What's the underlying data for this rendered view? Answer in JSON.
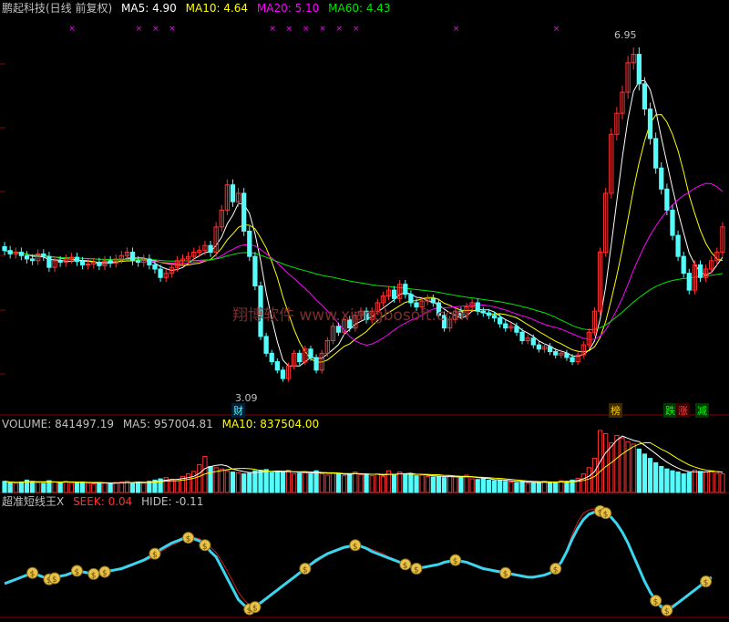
{
  "header": {
    "title": "鹏起科技(日线 前复权)",
    "ma5": "MA5: 4.90",
    "ma10": "MA10: 4.64",
    "ma20": "MA20: 5.10",
    "ma60": "MA60: 4.43"
  },
  "volume_header": {
    "label": "VOLUME: 841497.19",
    "ma5": "MA5: 957004.81",
    "ma10": "MA10: 837504.00"
  },
  "indicator_header": {
    "name": "超准短线王X",
    "seek": "SEEK: 0.04",
    "hide": "HIDE: -0.11"
  },
  "annotations": {
    "high_label": "6.95",
    "low_label": "3.09",
    "cai": "财",
    "bang": "榜",
    "die": "跌",
    "zhang": "涨",
    "jian": "减",
    "watermark": "翔博软件 www.xiangbosoft.com"
  },
  "colors": {
    "up": "#ff3232",
    "down": "#54fcfc",
    "ma5": "#ffffff",
    "ma10": "#ffff00",
    "ma20": "#ff00ff",
    "ma60": "#00e600",
    "seek": "#3ad6f0",
    "hide": "#cc1a1a",
    "marker": "#ff00ff"
  },
  "chart_data": {
    "type": "candlestick",
    "price_range": [
      2.7,
      7.4
    ],
    "closes": [
      4.62,
      4.58,
      4.6,
      4.56,
      4.52,
      4.5,
      4.58,
      4.55,
      4.42,
      4.5,
      4.48,
      4.52,
      4.54,
      4.49,
      4.45,
      4.46,
      4.48,
      4.44,
      4.5,
      4.47,
      4.52,
      4.56,
      4.6,
      4.5,
      4.48,
      4.52,
      4.45,
      4.4,
      4.3,
      4.35,
      4.42,
      4.5,
      4.52,
      4.55,
      4.6,
      4.62,
      4.68,
      4.6,
      4.9,
      5.1,
      5.4,
      5.2,
      5.3,
      4.85,
      4.55,
      4.2,
      3.6,
      3.4,
      3.3,
      3.2,
      3.1,
      3.25,
      3.4,
      3.3,
      3.45,
      3.35,
      3.2,
      3.4,
      3.55,
      3.72,
      3.65,
      3.8,
      3.7,
      3.85,
      3.9,
      3.8,
      3.9,
      4.0,
      4.08,
      4.15,
      4.05,
      4.22,
      4.1,
      4.0,
      3.95,
      4.02,
      4.05,
      4.0,
      3.85,
      3.7,
      3.8,
      3.9,
      3.85,
      3.95,
      4.0,
      3.9,
      3.88,
      3.85,
      3.82,
      3.75,
      3.7,
      3.72,
      3.65,
      3.55,
      3.58,
      3.5,
      3.45,
      3.48,
      3.42,
      3.38,
      3.4,
      3.35,
      3.3,
      3.38,
      3.5,
      3.65,
      3.9,
      4.6,
      5.3,
      6.0,
      6.25,
      6.5,
      6.85,
      6.95,
      6.6,
      6.3,
      5.95,
      5.6,
      5.35,
      5.1,
      4.8,
      4.55,
      4.35,
      4.15,
      4.45,
      4.3,
      4.4,
      4.5,
      4.6,
      4.9
    ],
    "volumes": [
      0.18,
      0.16,
      0.15,
      0.17,
      0.2,
      0.18,
      0.16,
      0.15,
      0.19,
      0.17,
      0.16,
      0.18,
      0.15,
      0.16,
      0.17,
      0.15,
      0.14,
      0.16,
      0.15,
      0.14,
      0.16,
      0.17,
      0.18,
      0.16,
      0.17,
      0.15,
      0.18,
      0.2,
      0.22,
      0.24,
      0.21,
      0.19,
      0.26,
      0.3,
      0.34,
      0.45,
      0.58,
      0.42,
      0.4,
      0.38,
      0.35,
      0.33,
      0.32,
      0.3,
      0.31,
      0.35,
      0.36,
      0.37,
      0.32,
      0.34,
      0.33,
      0.36,
      0.3,
      0.31,
      0.32,
      0.3,
      0.35,
      0.3,
      0.28,
      0.32,
      0.3,
      0.27,
      0.3,
      0.33,
      0.29,
      0.28,
      0.27,
      0.3,
      0.26,
      0.35,
      0.28,
      0.33,
      0.3,
      0.29,
      0.27,
      0.28,
      0.26,
      0.25,
      0.26,
      0.24,
      0.27,
      0.25,
      0.24,
      0.28,
      0.22,
      0.21,
      0.22,
      0.2,
      0.19,
      0.2,
      0.18,
      0.17,
      0.16,
      0.18,
      0.15,
      0.16,
      0.17,
      0.18,
      0.16,
      0.17,
      0.19,
      0.18,
      0.2,
      0.23,
      0.3,
      0.4,
      0.55,
      1.0,
      0.95,
      0.8,
      0.92,
      0.88,
      0.82,
      0.78,
      0.7,
      0.62,
      0.55,
      0.48,
      0.42,
      0.38,
      0.35,
      0.33,
      0.3,
      0.32,
      0.36,
      0.34,
      0.33,
      0.35,
      0.31,
      0.3
    ],
    "seek": [
      0.3,
      0.32,
      0.34,
      0.36,
      0.38,
      0.4,
      0.38,
      0.36,
      0.34,
      0.35,
      0.37,
      0.38,
      0.4,
      0.42,
      0.41,
      0.4,
      0.39,
      0.4,
      0.41,
      0.42,
      0.43,
      0.44,
      0.46,
      0.48,
      0.5,
      0.52,
      0.55,
      0.58,
      0.62,
      0.65,
      0.68,
      0.7,
      0.72,
      0.73,
      0.72,
      0.7,
      0.66,
      0.6,
      0.55,
      0.45,
      0.35,
      0.25,
      0.15,
      0.1,
      0.06,
      0.08,
      0.12,
      0.16,
      0.2,
      0.24,
      0.28,
      0.32,
      0.36,
      0.4,
      0.44,
      0.48,
      0.52,
      0.55,
      0.58,
      0.6,
      0.62,
      0.64,
      0.65,
      0.66,
      0.65,
      0.63,
      0.6,
      0.58,
      0.56,
      0.54,
      0.52,
      0.5,
      0.48,
      0.46,
      0.44,
      0.45,
      0.46,
      0.47,
      0.48,
      0.5,
      0.51,
      0.52,
      0.51,
      0.5,
      0.48,
      0.46,
      0.44,
      0.43,
      0.42,
      0.41,
      0.4,
      0.39,
      0.38,
      0.37,
      0.36,
      0.36,
      0.37,
      0.38,
      0.4,
      0.44,
      0.5,
      0.6,
      0.72,
      0.82,
      0.9,
      0.95,
      0.97,
      0.98,
      0.96,
      0.92,
      0.86,
      0.78,
      0.68,
      0.56,
      0.44,
      0.32,
      0.22,
      0.14,
      0.08,
      0.05,
      0.08,
      0.12,
      0.16,
      0.2,
      0.24,
      0.28,
      0.32,
      0.36
    ],
    "hide": [
      0.29,
      0.31,
      0.33,
      0.35,
      0.37,
      0.39,
      0.39,
      0.37,
      0.35,
      0.35,
      0.36,
      0.37,
      0.39,
      0.41,
      0.41,
      0.4,
      0.4,
      0.4,
      0.41,
      0.42,
      0.43,
      0.44,
      0.45,
      0.47,
      0.49,
      0.51,
      0.53,
      0.56,
      0.6,
      0.63,
      0.66,
      0.68,
      0.71,
      0.73,
      0.73,
      0.72,
      0.69,
      0.64,
      0.59,
      0.51,
      0.42,
      0.32,
      0.22,
      0.15,
      0.1,
      0.09,
      0.11,
      0.15,
      0.19,
      0.23,
      0.27,
      0.31,
      0.35,
      0.39,
      0.43,
      0.47,
      0.5,
      0.54,
      0.57,
      0.59,
      0.61,
      0.63,
      0.64,
      0.65,
      0.65,
      0.64,
      0.62,
      0.6,
      0.58,
      0.55,
      0.53,
      0.51,
      0.49,
      0.47,
      0.45,
      0.45,
      0.46,
      0.47,
      0.48,
      0.49,
      0.5,
      0.51,
      0.51,
      0.5,
      0.49,
      0.47,
      0.45,
      0.44,
      0.43,
      0.42,
      0.41,
      0.4,
      0.39,
      0.38,
      0.37,
      0.36,
      0.37,
      0.38,
      0.39,
      0.43,
      0.5,
      0.62,
      0.76,
      0.88,
      0.96,
      0.99,
      1.0,
      0.99,
      0.97,
      0.93,
      0.87,
      0.79,
      0.69,
      0.57,
      0.45,
      0.33,
      0.23,
      0.15,
      0.1,
      0.08,
      0.1,
      0.13,
      0.17,
      0.21,
      0.25,
      0.29,
      0.33,
      0.37
    ]
  }
}
